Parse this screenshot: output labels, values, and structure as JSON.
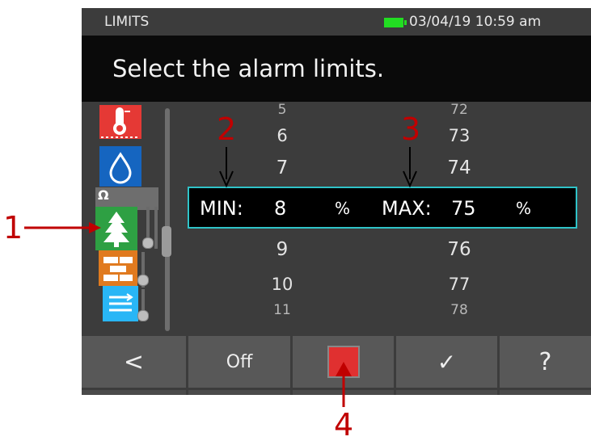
{
  "status": {
    "mode": "LIMITS",
    "datetime": "03/04/19 10:59 am"
  },
  "prompt": "Select the alarm limits.",
  "categories": [
    {
      "name": "temperature",
      "icon": "thermometer-icon",
      "color": "#e53935"
    },
    {
      "name": "water",
      "icon": "water-drop-icon",
      "color": "#1565c0"
    },
    {
      "name": "wood",
      "icon": "tree-icon",
      "color": "#2ea043",
      "badge": "Ω"
    },
    {
      "name": "building",
      "icon": "brick-icon",
      "color": "#e07a1f"
    },
    {
      "name": "material",
      "icon": "layers-icon",
      "color": "#29b6f6"
    }
  ],
  "min_values": {
    "above": [
      "5",
      "6",
      "7"
    ],
    "below": [
      "9",
      "10",
      "11"
    ]
  },
  "max_values": {
    "above": [
      "72",
      "73",
      "74"
    ],
    "below": [
      "76",
      "77",
      "78"
    ]
  },
  "selected": {
    "min_label": "MIN:",
    "min_value": "8",
    "min_unit": "%",
    "max_label": "MAX:",
    "max_value": "75",
    "max_unit": "%"
  },
  "softkeys": {
    "back": "<",
    "off": "Off",
    "confirm": "✓",
    "help": "?"
  },
  "annotations": {
    "a1": "1",
    "a2": "2",
    "a3": "3",
    "a4": "4"
  },
  "colors": {
    "highlight_border": "#2fc3c8",
    "annotation_red": "#c00000",
    "battery": "#22dd22"
  }
}
